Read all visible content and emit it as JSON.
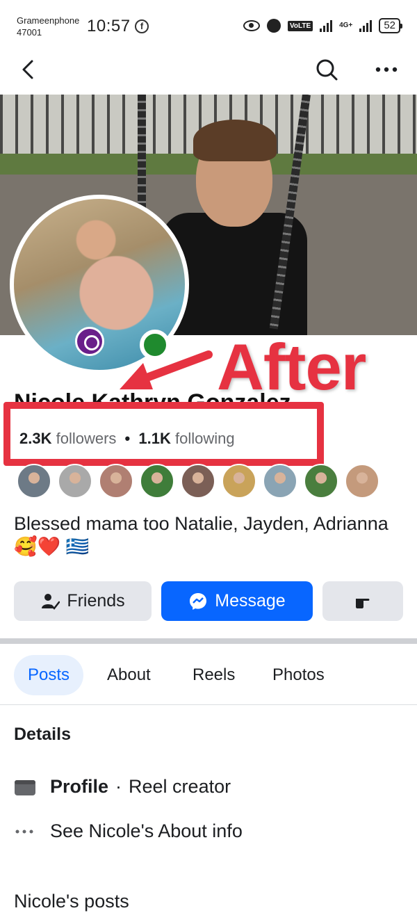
{
  "status_bar": {
    "carrier": "Grameenphone",
    "carrier_code": "47001",
    "time": "10:57",
    "network": "4G+",
    "volte": "VoLTE",
    "battery": "52"
  },
  "header": {
    "icons": [
      "back-arrow-icon",
      "search-icon",
      "more-options-icon"
    ]
  },
  "profile": {
    "name": "Nicole Kathryn Gonzalez",
    "followers_count": "2.3K",
    "followers_label": "followers",
    "separator": "•",
    "following_count": "1.1K",
    "following_label": "following",
    "bio": "Blessed mama too Natalie, Jayden, Adrianna 🥰❤️ 🇬🇷",
    "online": true
  },
  "annotation": {
    "label": "After",
    "color": "#e63241"
  },
  "followers_preview": [
    "#6d7a86",
    "#a9a9a9",
    "#b07f72",
    "#3f7d3a",
    "#7b5f56",
    "#c9a35a",
    "#8aa4b4",
    "#4a7e3e",
    "#c49a7c"
  ],
  "actions": {
    "friends_label": "Friends",
    "message_label": "Message"
  },
  "tabs": {
    "posts": "Posts",
    "about": "About",
    "reels": "Reels",
    "photos": "Photos"
  },
  "details": {
    "title": "Details",
    "profile_label": "Profile",
    "profile_separator": "·",
    "profile_type": "Reel creator",
    "about_link": "See Nicole's About info"
  },
  "posts_section": {
    "title": "Nicole's posts"
  },
  "colors": {
    "brand_blue": "#0866ff",
    "button_gray": "#e4e6eb",
    "online_green": "#1f8a2e"
  }
}
